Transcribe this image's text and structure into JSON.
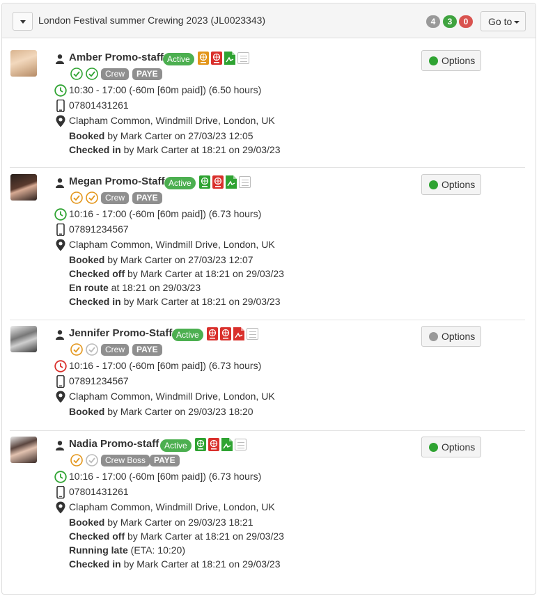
{
  "header": {
    "title": "London Festival summer Crewing 2023 (JL0023343)",
    "counts": [
      "4",
      "3",
      "0"
    ],
    "goto_label": "Go to"
  },
  "colors": {
    "active": "#4caf50",
    "online": "#2fa332",
    "offline": "#999999",
    "warn": "#e3961b",
    "danger": "#d9302c"
  },
  "staff": [
    {
      "name": "Amber Promo-staff",
      "status": "Active",
      "tags": [
        "Crew",
        "PAYE"
      ],
      "time": "10:30 - 17:00 (-60m [60m paid]) (6.50 hours)",
      "phone": "07801431261",
      "address": "Clapham Common, Windmill Drive, London, UK",
      "events": [
        {
          "label": "Booked",
          "text": " by Mark Carter on 27/03/23 12:05"
        },
        {
          "label": "Checked in",
          "text": " by Mark Carter at 18:21 on 29/03/23"
        }
      ],
      "options_label": "Options",
      "check_colors": [
        "green",
        "green"
      ],
      "option_dot": "online",
      "doc_icons": [
        "orange-passport-icon",
        "red-passport-icon",
        "green-pdf-icon"
      ]
    },
    {
      "name": "Megan Promo-Staff",
      "status": "Active",
      "tags": [
        "Crew",
        "PAYE"
      ],
      "time": "10:16 - 17:00 (-60m [60m paid]) (6.73 hours)",
      "phone": "07891234567",
      "address": "Clapham Common, Windmill Drive, London, UK",
      "events": [
        {
          "label": "Booked",
          "text": " by Mark Carter on 27/03/23 12:07"
        },
        {
          "label": "Checked off",
          "text": " by Mark Carter at 18:21 on 29/03/23"
        },
        {
          "label": "En route",
          "text": " at 18:21 on 29/03/23"
        },
        {
          "label": "Checked in",
          "text": " by Mark Carter at 18:21 on 29/03/23"
        }
      ],
      "options_label": "Options",
      "check_colors": [
        "orange",
        "orange"
      ],
      "option_dot": "online"
    },
    {
      "name": "Jennifer Promo-Staff",
      "status": "Active",
      "tags": [
        "Crew",
        "PAYE"
      ],
      "time": "10:16 - 17:00 (-60m [60m paid]) (6.73 hours)",
      "phone": "07891234567",
      "address": "Clapham Common, Windmill Drive, London, UK",
      "events": [
        {
          "label": "Booked",
          "text": " by Mark Carter on 29/03/23 18:20"
        }
      ],
      "options_label": "Options",
      "check_colors": [
        "orange",
        "grey"
      ],
      "option_dot": "offline"
    },
    {
      "name": "Nadia Promo-staff",
      "status": "Active",
      "tags": [
        "Crew Boss",
        "PAYE"
      ],
      "time": "10:16 - 17:00 (-60m [60m paid]) (6.73 hours)",
      "phone": "07801431261",
      "address": "Clapham Common, Windmill Drive, London, UK",
      "events": [
        {
          "label": "Booked",
          "text": " by Mark Carter on 29/03/23 18:21"
        },
        {
          "label": "Checked off",
          "text": " by Mark Carter at 18:21 on 29/03/23"
        },
        {
          "label": "Running late",
          "text": " (ETA: 10:20)"
        },
        {
          "label": "Checked in",
          "text": " by Mark Carter at 18:21 on 29/03/23"
        }
      ],
      "options_label": "Options",
      "check_colors": [
        "orange",
        "grey"
      ],
      "option_dot": "online"
    }
  ]
}
